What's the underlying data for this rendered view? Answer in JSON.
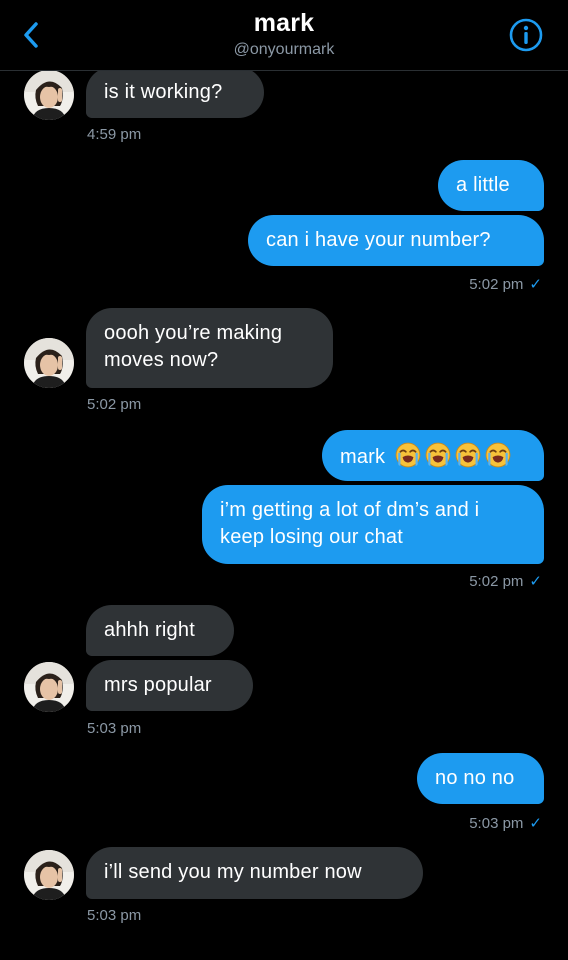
{
  "header": {
    "name": "mark",
    "handle": "@onyourmark"
  },
  "colors": {
    "accent": "#1d9bf0",
    "incoming_bubble": "#2f3336",
    "background": "#000000",
    "secondary_text": "#8b98a5"
  },
  "icons": {
    "back": "chevron-left-icon",
    "info": "info-circle-icon",
    "sent": "checkmark-icon",
    "emoji": "loudly-crying-face-emoji"
  },
  "messages": [
    {
      "dir": "in",
      "text": "is it working?"
    },
    {
      "time": "4:59 pm"
    },
    {
      "dir": "out",
      "text": "a little"
    },
    {
      "dir": "out",
      "text": "can i have your number?"
    },
    {
      "time": "5:02 pm",
      "check": "✓"
    },
    {
      "dir": "in",
      "line1": "oooh you’re making",
      "line2": "moves now?"
    },
    {
      "time": "5:02 pm"
    },
    {
      "dir": "out",
      "text": "mark",
      "emoji_count": 4
    },
    {
      "dir": "out",
      "line1": "i’m getting a lot of dm’s and i",
      "line2": "keep losing our chat"
    },
    {
      "time": "5:02 pm",
      "check": "✓"
    },
    {
      "dir": "in",
      "text": "ahhh right"
    },
    {
      "dir": "in",
      "text": "mrs popular"
    },
    {
      "time": "5:03 pm"
    },
    {
      "dir": "out",
      "text": "no no no"
    },
    {
      "time": "5:03 pm",
      "check": "✓"
    },
    {
      "dir": "in",
      "text": "i’ll send you my number now"
    },
    {
      "time": "5:03 pm"
    }
  ]
}
